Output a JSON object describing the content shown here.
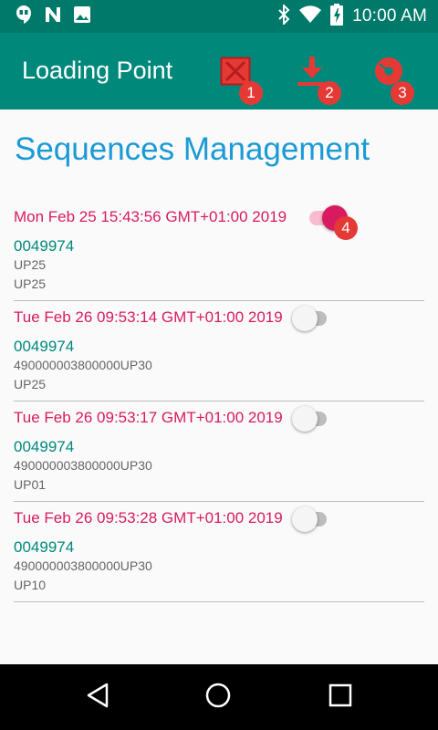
{
  "status_bar": {
    "time": "10:00 AM",
    "icons": [
      "hangouts-icon",
      "n-notification-icon",
      "image-icon",
      "bluetooth-icon",
      "wifi-icon",
      "battery-charging-icon"
    ]
  },
  "app_bar": {
    "title": "Loading Point",
    "actions": [
      {
        "icon": "close-box-icon",
        "badge": "1"
      },
      {
        "icon": "download-icon",
        "badge": "2"
      },
      {
        "icon": "disc-icon",
        "badge": "3"
      }
    ]
  },
  "main": {
    "title": "Sequences Management",
    "sequences": [
      {
        "date": "Mon Feb 25 15:43:56 GMT+01:00 2019",
        "code": "0049974",
        "line1": "UP25",
        "line2": "UP25",
        "enabled": true,
        "badge": "4"
      },
      {
        "date": "Tue Feb 26 09:53:14 GMT+01:00 2019",
        "code": "0049974",
        "line1": "490000003800000UP30",
        "line2": "UP25",
        "enabled": false
      },
      {
        "date": "Tue Feb 26 09:53:17 GMT+01:00 2019",
        "code": "0049974",
        "line1": "490000003800000UP30",
        "line2": "UP01",
        "enabled": false
      },
      {
        "date": "Tue Feb 26 09:53:28 GMT+01:00 2019",
        "code": "0049974",
        "line1": "490000003800000UP30",
        "line2": "UP10",
        "enabled": false
      }
    ]
  },
  "nav_bar": {
    "buttons": [
      "back-icon",
      "home-icon",
      "recents-icon"
    ]
  },
  "colors": {
    "status_bar": "#00796b",
    "app_bar": "#00897b",
    "accent_pink": "#d81b60",
    "title_blue": "#1a9ad6",
    "badge_red": "#e53935"
  }
}
